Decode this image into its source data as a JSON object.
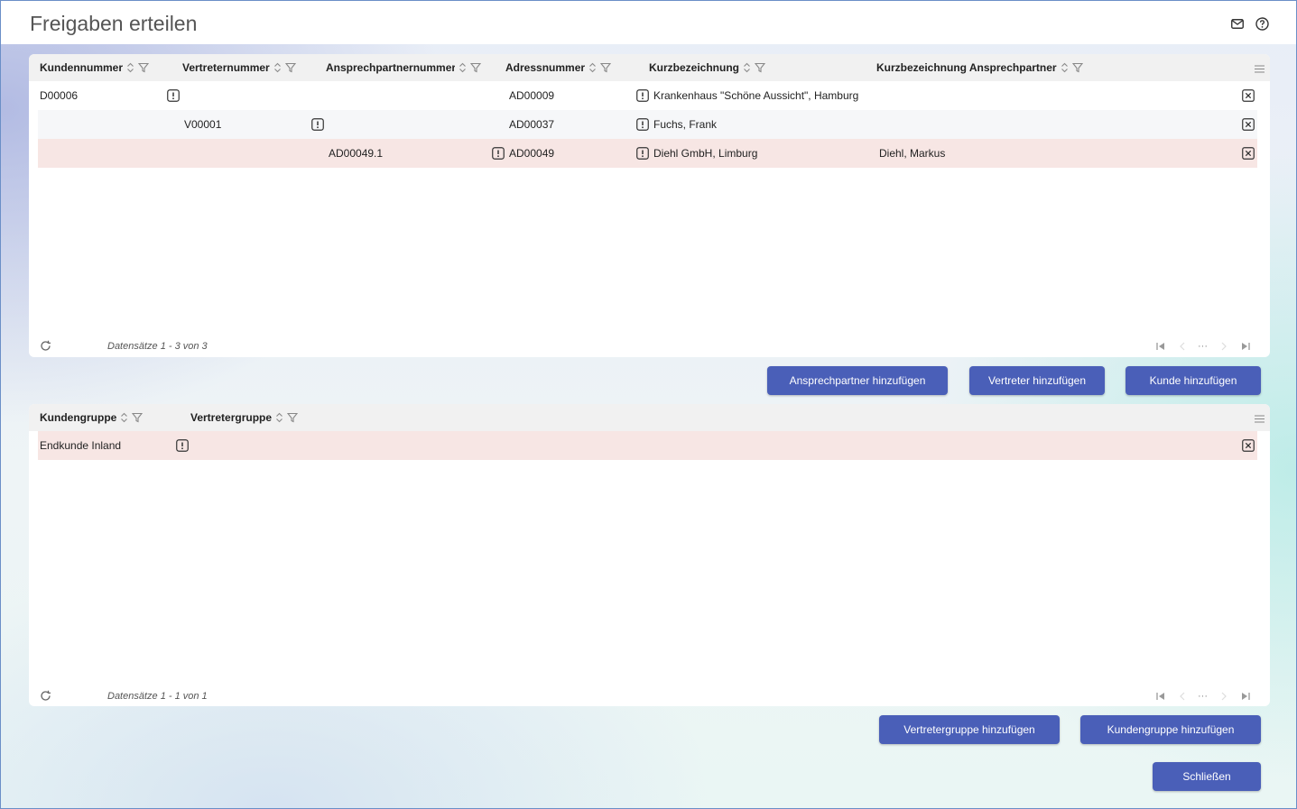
{
  "window": {
    "title": "Freigaben erteilen"
  },
  "table1": {
    "columns": [
      "Kundennummer",
      "Vertreternummer",
      "Ansprechpartnernummer",
      "Adressnummer",
      "Kurzbezeichnung",
      "Kurzbezeichnung Ansprechpartner"
    ],
    "rows": [
      {
        "kundennummer": "D00006",
        "vertreternummer": "",
        "ansprechpartnernummer": "",
        "adressnummer": "AD00009",
        "kurzbezeichnung": "Krankenhaus \"Schöne Aussicht\", Hamburg",
        "kurzbezeichnung_ap": ""
      },
      {
        "kundennummer": "",
        "vertreternummer": "V00001",
        "ansprechpartnernummer": "",
        "adressnummer": "AD00037",
        "kurzbezeichnung": "Fuchs, Frank",
        "kurzbezeichnung_ap": ""
      },
      {
        "kundennummer": "",
        "vertreternummer": "",
        "ansprechpartnernummer": "AD00049.1",
        "adressnummer": "AD00049",
        "kurzbezeichnung": "Diehl GmbH, Limburg",
        "kurzbezeichnung_ap": "Diehl, Markus"
      }
    ],
    "records": "Datensätze 1 - 3 von 3",
    "pager_ellipsis": "···"
  },
  "actions1": {
    "add_contact": "Ansprechpartner hinzufügen",
    "add_rep": "Vertreter hinzufügen",
    "add_customer": "Kunde hinzufügen"
  },
  "table2": {
    "columns": [
      "Kundengruppe",
      "Vertretergruppe"
    ],
    "rows": [
      {
        "kundengruppe": "Endkunde Inland",
        "vertretergruppe": ""
      }
    ],
    "records": "Datensätze 1 - 1 von 1",
    "pager_ellipsis": "···"
  },
  "actions2": {
    "add_rep_group": "Vertretergruppe hinzufügen",
    "add_customer_group": "Kundengruppe hinzufügen"
  },
  "close_label": "Schließen",
  "icons": [
    "mail-icon",
    "help-icon",
    "sort-icon",
    "filter-icon",
    "column-menu-icon",
    "info-icon",
    "delete-icon",
    "refresh-icon",
    "first-page-icon",
    "prev-page-icon",
    "next-page-icon",
    "last-page-icon"
  ],
  "colors": {
    "accent": "#4a5fb8",
    "highlight_row": "#f7e6e4",
    "header_bg": "#f1f1f1"
  }
}
